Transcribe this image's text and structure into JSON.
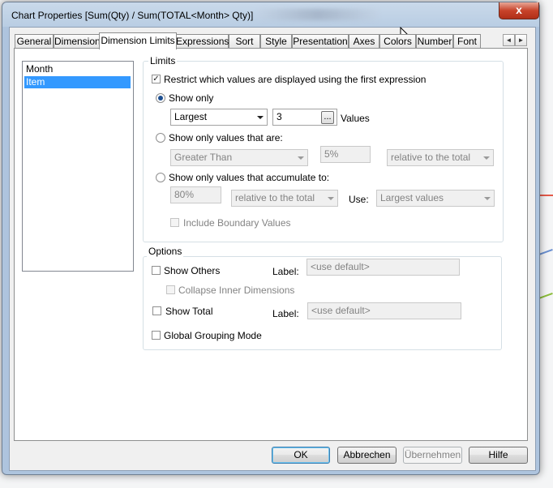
{
  "window": {
    "title": "Chart Properties [Sum(Qty) / Sum(TOTAL<Month> Qty)]",
    "close_label": "x"
  },
  "tabs": [
    {
      "label": "General"
    },
    {
      "label": "Dimensions"
    },
    {
      "label": "Dimension Limits",
      "active": true
    },
    {
      "label": "Expressions"
    },
    {
      "label": "Sort"
    },
    {
      "label": "Style"
    },
    {
      "label": "Presentation"
    },
    {
      "label": "Axes"
    },
    {
      "label": "Colors"
    },
    {
      "label": "Number"
    },
    {
      "label": "Font"
    }
  ],
  "tab_scroll": {
    "left": "◄",
    "right": "►"
  },
  "dimensions_list": {
    "items": [
      {
        "label": "Month",
        "selected": false
      },
      {
        "label": "Item",
        "selected": true
      }
    ]
  },
  "limits": {
    "group_title": "Limits",
    "restrict_label": "Restrict which values are displayed using the first expression",
    "restrict_checked": true,
    "show_only": {
      "label": "Show only",
      "selected": true,
      "combo_value": "Largest",
      "count_value": "3",
      "dots_label": "...",
      "values_label": "Values"
    },
    "show_only_values": {
      "label": "Show only values that are:",
      "selected": false,
      "operator_value": "Greater Than",
      "percent_value": "5%",
      "relative_value": "relative to the total"
    },
    "accumulate": {
      "label": "Show only values that accumulate to:",
      "selected": false,
      "percent_value": "80%",
      "relative_value": "relative to the total",
      "use_label": "Use:",
      "use_value": "Largest values"
    },
    "include_boundary_label": "Include Boundary Values",
    "include_boundary_checked": false
  },
  "options": {
    "group_title": "Options",
    "show_others_label": "Show Others",
    "show_others_checked": false,
    "others_label_label": "Label:",
    "others_label_placeholder": "<use default>",
    "collapse_label": "Collapse Inner Dimensions",
    "collapse_checked": false,
    "show_total_label": "Show Total",
    "show_total_checked": false,
    "total_label_label": "Label:",
    "total_label_placeholder": "<use default>",
    "global_grouping_label": "Global Grouping Mode",
    "global_grouping_checked": false
  },
  "buttons": {
    "ok": "OK",
    "cancel": "Abbrechen",
    "apply": "Übernehmen",
    "help": "Hilfe"
  },
  "colors": {
    "selection": "#3399ff",
    "titlebar": "#b9cde3",
    "close": "#c7432a"
  }
}
